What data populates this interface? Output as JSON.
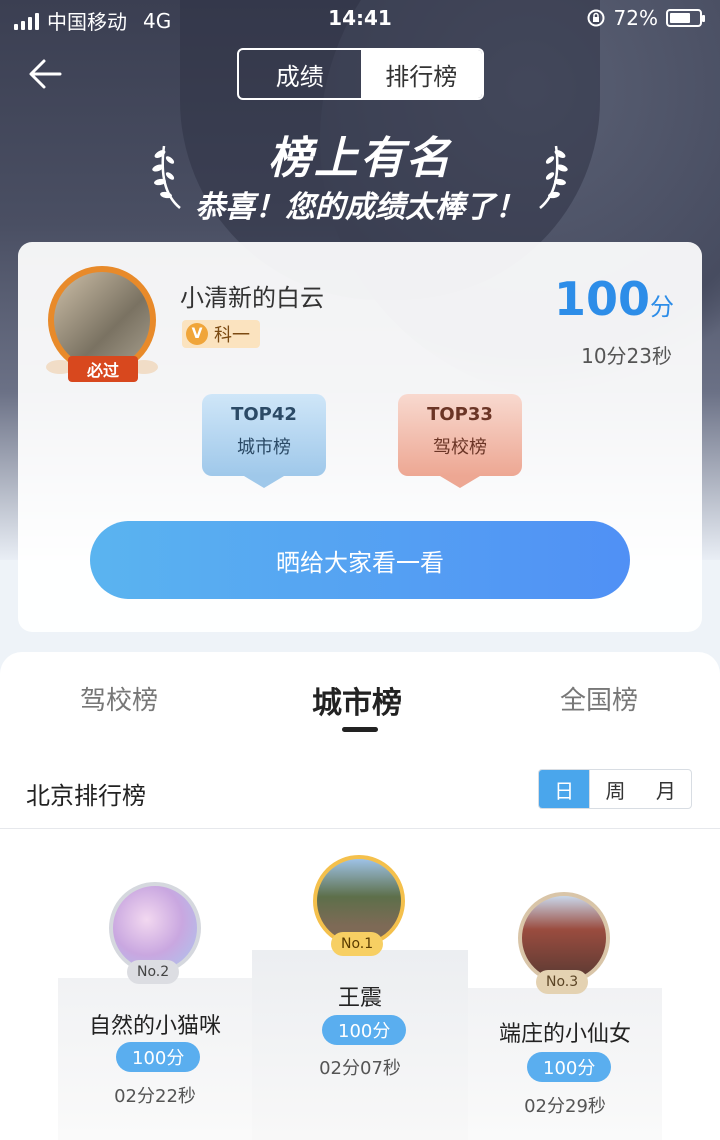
{
  "status_bar": {
    "carrier": "中国移动",
    "network": "4G",
    "time": "14:41",
    "battery": "72%",
    "battery_level": 0.72
  },
  "header": {
    "back_icon": "back-arrow-icon",
    "tabs": [
      {
        "label": "成绩",
        "active": false
      },
      {
        "label": "排行榜",
        "active": true
      }
    ]
  },
  "hero": {
    "headline": "榜上有名",
    "subline": "恭喜！您的成绩太棒了！"
  },
  "result_card": {
    "username": "小清新的白云",
    "pass_badge": "必过",
    "subject": "科一",
    "subject_icon": "V",
    "score": "100",
    "score_unit": "分",
    "duration": "10分23秒",
    "ranks": [
      {
        "top": "TOP42",
        "label": "城市榜"
      },
      {
        "top": "TOP33",
        "label": "驾校榜"
      }
    ],
    "share_label": "晒给大家看一看"
  },
  "leaderboard": {
    "tabs": [
      {
        "label": "驾校榜"
      },
      {
        "label": "城市榜",
        "active": true
      },
      {
        "label": "全国榜"
      }
    ],
    "title": "北京排行榜",
    "periods": [
      {
        "label": "日",
        "active": true
      },
      {
        "label": "周"
      },
      {
        "label": "月"
      }
    ],
    "podium": [
      {
        "rank": "No.2",
        "name": "自然的小猫咪",
        "score": "100分",
        "time": "02分22秒"
      },
      {
        "rank": "No.1",
        "name": "王震",
        "score": "100分",
        "time": "02分07秒"
      },
      {
        "rank": "No.3",
        "name": "端庄的小仙女",
        "score": "100分",
        "time": "02分29秒"
      }
    ]
  },
  "colors": {
    "accent_blue": "#2d8de8",
    "button_gradient_start": "#5ab4f0",
    "button_gradient_end": "#5090f5",
    "gold": "#f4c04c"
  }
}
